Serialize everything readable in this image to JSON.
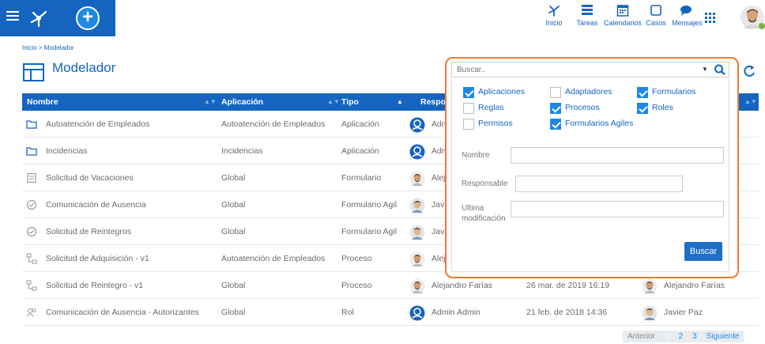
{
  "topnav": {
    "inicio": "Inicio",
    "tareas": "Tareas",
    "calendarios": "Calendarios",
    "casos": "Casos",
    "mensajes": "Mensajes"
  },
  "breadcrumb": "Inicio > Modelador",
  "page_title": "Modelador",
  "table": {
    "headers": [
      "Nombre",
      "Aplicación",
      "Tipo",
      "Responsable"
    ],
    "rows": [
      {
        "icon": "folder-icon",
        "nombre": "Autoatención de Empleados",
        "aplicacion": "Autoatención de Empleados",
        "tipo": "Aplicación",
        "responsable": "Adm"
      },
      {
        "icon": "folder-icon",
        "nombre": "Incidencias",
        "aplicacion": "Incidencias",
        "tipo": "Aplicación",
        "responsable": "Adm"
      },
      {
        "icon": "form-icon",
        "nombre": "Solicitud de Vacaciones",
        "aplicacion": "Global",
        "tipo": "Formulario",
        "responsable": "Alej"
      },
      {
        "icon": "agile-form-icon",
        "nombre": "Comunicación de Ausencia",
        "aplicacion": "Global",
        "tipo": "Formulario Agil",
        "responsable": "Javi"
      },
      {
        "icon": "agile-form-icon",
        "nombre": "Solicitud de Reintegros",
        "aplicacion": "Global",
        "tipo": "Formulario Agil",
        "responsable": "Javi"
      },
      {
        "icon": "process-icon",
        "nombre": "Solicitud de Adquisición - v1",
        "aplicacion": "Autoatención de Empleados",
        "tipo": "Proceso",
        "responsable": "Alej"
      },
      {
        "icon": "process-icon",
        "nombre": "Solicitud de Reintegro - v1",
        "aplicacion": "Global",
        "tipo": "Proceso",
        "responsable": "Alejandro Farías",
        "fecha": "26 mar. de 2019 16:19",
        "modificado_por": "Alejandro Farías"
      },
      {
        "icon": "role-icon",
        "nombre": "Comunicación de Ausencia - Autorizantes",
        "aplicacion": "Global",
        "tipo": "Rol",
        "responsable": "Admin Admin",
        "fecha": "21 feb. de 2018 14:36",
        "modificado_por": "Javier Paz"
      }
    ]
  },
  "pager": {
    "prev": "Anterior",
    "pages": [
      "1",
      "2",
      "3"
    ],
    "current": "1",
    "next": "Siguiente"
  },
  "search": {
    "placeholder": "Buscar..",
    "checkboxes": [
      {
        "label": "Aplicaciones",
        "checked": true
      },
      {
        "label": "Adaptadores",
        "checked": false
      },
      {
        "label": "Formularios",
        "checked": true
      },
      {
        "label": "Reglas",
        "checked": false
      },
      {
        "label": "Procesos",
        "checked": true
      },
      {
        "label": "Roles",
        "checked": true
      },
      {
        "label": "Permisos",
        "checked": false
      },
      {
        "label": "Formularios Agiles",
        "checked": true
      }
    ],
    "fields": {
      "nombre": "Nombre",
      "responsable": "Responsable",
      "ultima_1": "Ultima",
      "ultima_2": "modificación"
    },
    "button": "Buscar"
  },
  "colors": {
    "primary": "#1565c0",
    "highlight": "#ef7a32"
  }
}
